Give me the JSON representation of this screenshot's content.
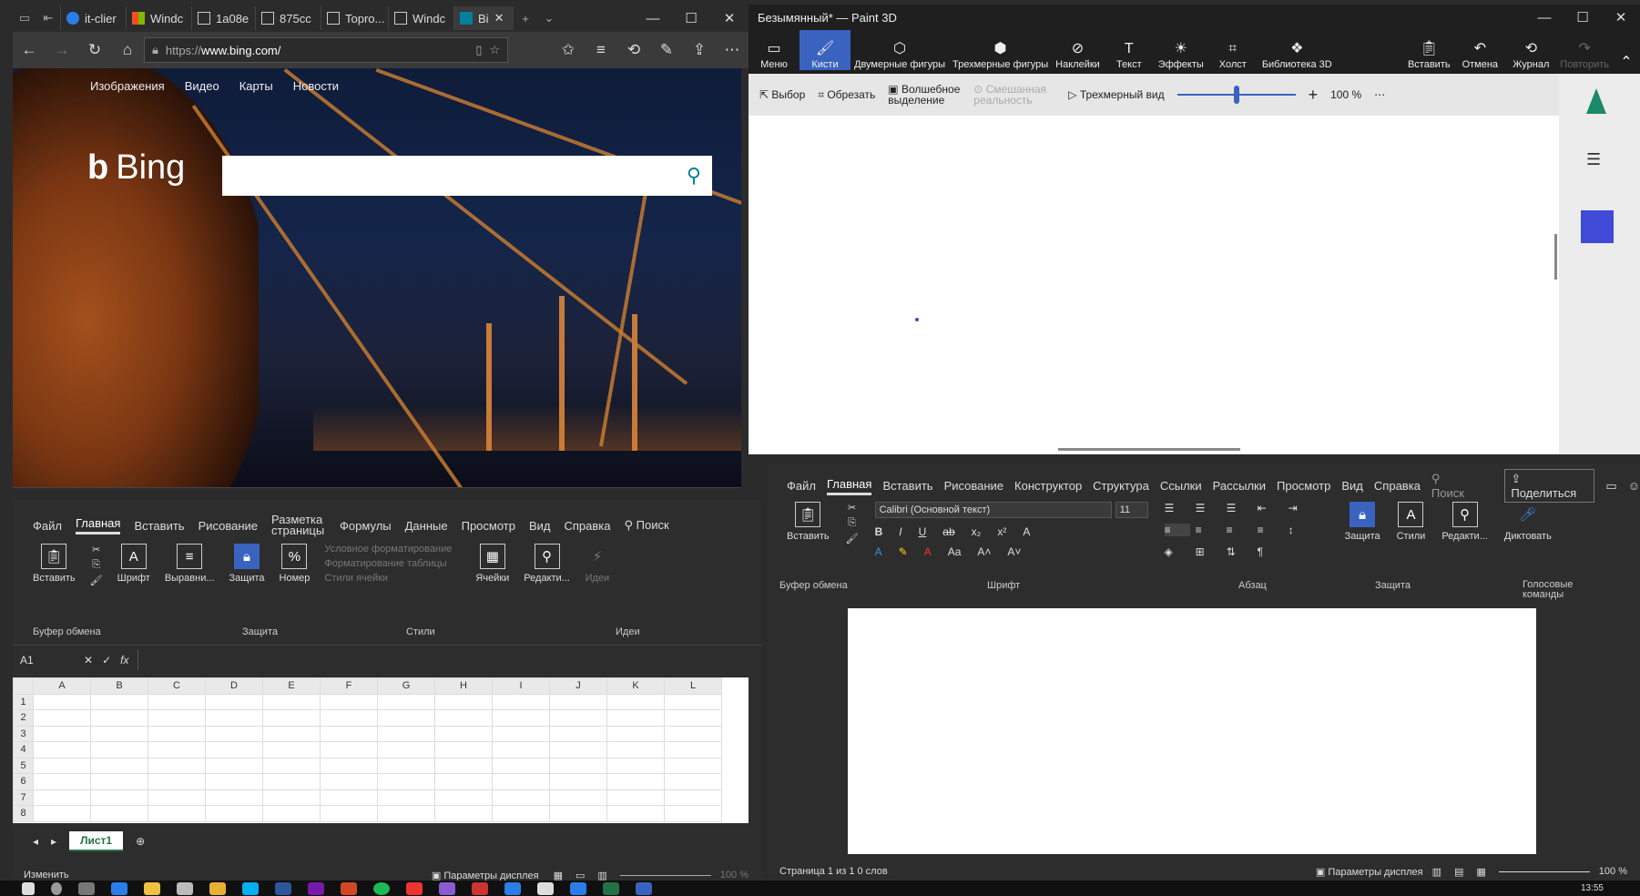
{
  "edge": {
    "tabs": [
      "it-clier",
      "Windc",
      "1a08e",
      "875cc",
      "Topro...",
      "Windc",
      "Bi"
    ],
    "url_prefix": "https://",
    "url_host": "www.bing.com/",
    "nav": [
      "Изображения",
      "Видео",
      "Карты",
      "Новости"
    ],
    "logo": "Bing"
  },
  "paint": {
    "title": "Безымянный* — Paint 3D",
    "tools": [
      "Меню",
      "Кисти",
      "Двумерные фигуры",
      "Трехмерные фигуры",
      "Наклейки",
      "Текст",
      "Эффекты",
      "Холст",
      "Библиотека 3D",
      "Вставить",
      "Отмена",
      "Журнал",
      "Повторить"
    ],
    "sub": {
      "select": "Выбор",
      "crop": "Обрезать",
      "magic": "Волшебное выделение",
      "mixed": "Смешанная реальность",
      "view3d": "Трехмерный вид",
      "zoom": "100 %"
    },
    "swatch_color": "#3f4bd6"
  },
  "excel": {
    "tabs": [
      "Файл",
      "Главная",
      "Вставить",
      "Рисование",
      "Разметка страницы",
      "Формулы",
      "Данные",
      "Просмотр",
      "Вид",
      "Справка"
    ],
    "search": "Поиск",
    "groups": {
      "clipboard": "Буфер обмена",
      "protection": "Защита",
      "styles": "Стили",
      "ideas": "Идеи"
    },
    "buttons": [
      "Вставить",
      "Шрифт",
      "Выравни...",
      "Защита",
      "Номер",
      "Ячейки",
      "Редакти...",
      "Идеи"
    ],
    "styles_items": [
      "Условное форматирование",
      "Форматирование таблицы",
      "Стили ячейки"
    ],
    "namebox": "A1",
    "cols": [
      "A",
      "B",
      "C",
      "D",
      "E",
      "F",
      "G",
      "H",
      "I",
      "J",
      "K",
      "L"
    ],
    "rows": [
      "1",
      "2",
      "3",
      "4",
      "5",
      "6",
      "7",
      "8"
    ],
    "sheet": "Лист1",
    "status": "Изменить",
    "display": "Параметры дисплея",
    "zoom": "100 %"
  },
  "word": {
    "tabs": [
      "Файл",
      "Главная",
      "Вставить",
      "Рисование",
      "Конструктор",
      "Структура",
      "Ссылки",
      "Рассылки",
      "Просмотр",
      "Вид",
      "Справка"
    ],
    "search": "Поиск",
    "share": "Поделиться",
    "font": "Calibri (Основной текст)",
    "size": "11",
    "groups": {
      "clipboard": "Буфер обмена",
      "font": "Шрифт",
      "paragraph": "Абзац",
      "protection": "Защита",
      "voice": "Голосовые команды"
    },
    "buttons": [
      "Вставить",
      "Защита",
      "Стили",
      "Редакти...",
      "Диктовать"
    ],
    "status": "Страница 1 из 1  0 слов",
    "display": "Параметры дисплея",
    "zoom": "100 %"
  },
  "taskbar": {
    "time": "13:55"
  }
}
